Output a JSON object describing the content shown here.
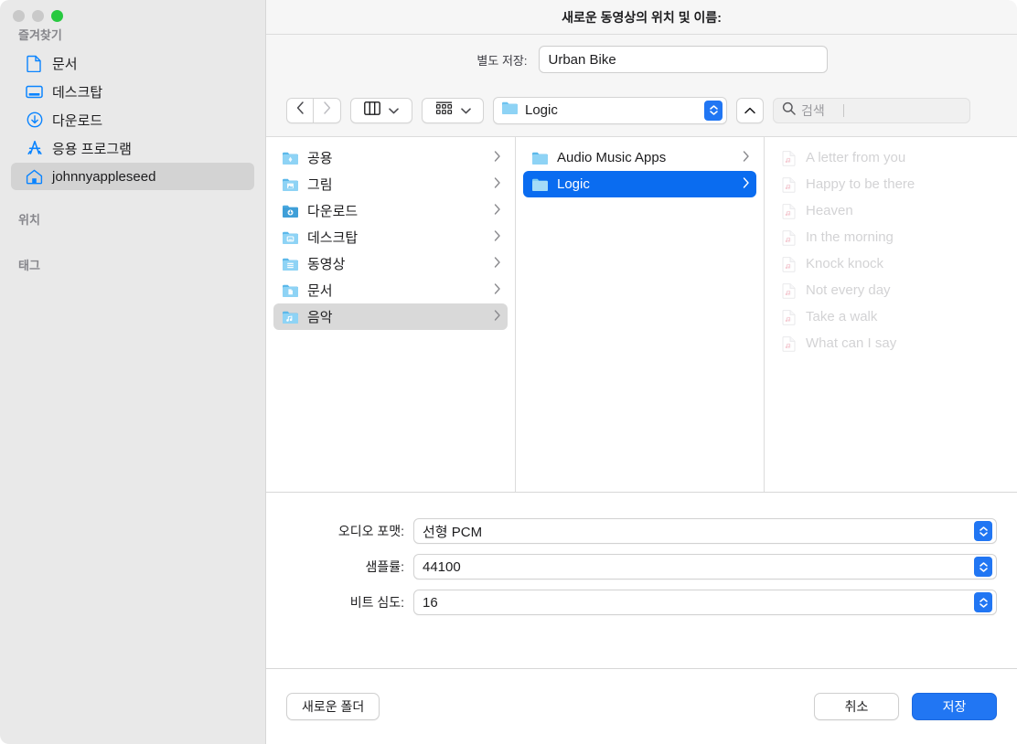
{
  "window": {
    "traffic_lights": [
      "close",
      "minimize",
      "zoom"
    ]
  },
  "dialog": {
    "title": "새로운 동영상의 위치 및 이름:"
  },
  "saveas": {
    "label": "별도 저장:",
    "value": "Urban Bike"
  },
  "toolbar": {
    "back_icon": "chevron-left-icon",
    "forward_icon": "chevron-right-icon",
    "view_icon": "column-view-icon",
    "group_icon": "group-view-icon",
    "path_label": "Logic",
    "path_icon": "folder-icon",
    "up_icon": "chevron-up-icon",
    "search_icon": "search-icon",
    "search_placeholder": "검색"
  },
  "sidebar": {
    "sections": [
      {
        "title": "즐겨찾기"
      },
      {
        "title": "위치"
      },
      {
        "title": "태그"
      }
    ],
    "favorites": [
      {
        "label": "문서",
        "icon": "document-icon",
        "selected": false
      },
      {
        "label": "데스크탑",
        "icon": "desktop-icon",
        "selected": false
      },
      {
        "label": "다운로드",
        "icon": "downloads-icon",
        "selected": false
      },
      {
        "label": "응용 프로그램",
        "icon": "applications-icon",
        "selected": false
      },
      {
        "label": "johnnyappleseed",
        "icon": "home-icon",
        "selected": true
      }
    ]
  },
  "browser": {
    "column1": [
      {
        "label": "공용",
        "icon": "folder-shared-icon",
        "state": "normal"
      },
      {
        "label": "그림",
        "icon": "folder-pictures-icon",
        "state": "normal"
      },
      {
        "label": "다운로드",
        "icon": "folder-downloads-icon",
        "state": "normal"
      },
      {
        "label": "데스크탑",
        "icon": "folder-desktop-icon",
        "state": "normal"
      },
      {
        "label": "동영상",
        "icon": "folder-movies-icon",
        "state": "normal"
      },
      {
        "label": "문서",
        "icon": "folder-documents-icon",
        "state": "normal"
      },
      {
        "label": "음악",
        "icon": "folder-music-icon",
        "state": "selected-inactive"
      }
    ],
    "column2": [
      {
        "label": "Audio Music Apps",
        "icon": "folder-icon",
        "state": "normal"
      },
      {
        "label": "Logic",
        "icon": "folder-icon",
        "state": "selected-active"
      }
    ],
    "column3": [
      {
        "label": "A letter from you",
        "icon": "music-file-icon",
        "state": "disabled"
      },
      {
        "label": "Happy to be there",
        "icon": "music-file-icon",
        "state": "disabled"
      },
      {
        "label": "Heaven",
        "icon": "music-file-icon",
        "state": "disabled"
      },
      {
        "label": "In the morning",
        "icon": "music-file-icon",
        "state": "disabled"
      },
      {
        "label": "Knock knock",
        "icon": "music-file-icon",
        "state": "disabled"
      },
      {
        "label": "Not every day",
        "icon": "music-file-icon",
        "state": "disabled"
      },
      {
        "label": "Take a walk",
        "icon": "music-file-icon",
        "state": "disabled"
      },
      {
        "label": "What can I say",
        "icon": "music-file-icon",
        "state": "disabled"
      }
    ]
  },
  "options": [
    {
      "label": "오디오 포맷:",
      "value": "선형 PCM"
    },
    {
      "label": "샘플률:",
      "value": "44100"
    },
    {
      "label": "비트 심도:",
      "value": "16"
    }
  ],
  "footer": {
    "new_folder": "새로운 폴더",
    "cancel": "취소",
    "save": "저장"
  },
  "colors": {
    "accent_blue": "#2176f3",
    "selection_blue": "#0a6cf0",
    "sidebar_bg": "#e9e9e9",
    "selection_grey": "#d9d9d9",
    "zoom_green": "#28c940"
  }
}
